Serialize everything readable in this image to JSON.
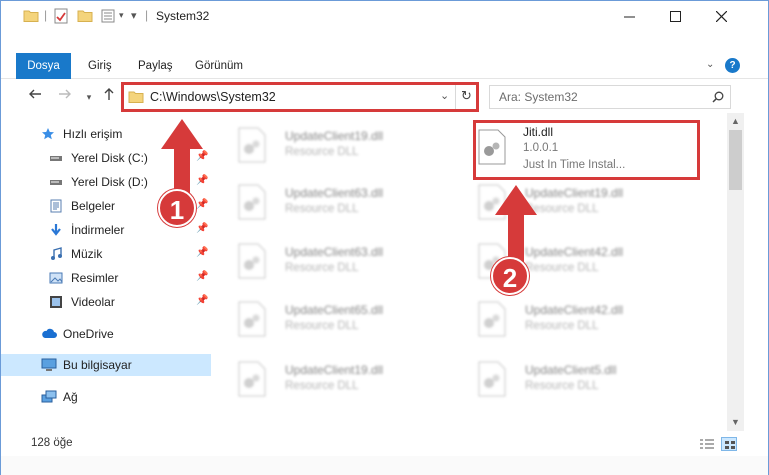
{
  "window": {
    "title": "System32"
  },
  "ribbon": {
    "tabs": [
      {
        "label": "Dosya",
        "active": true
      },
      {
        "label": "Giriş",
        "active": false
      },
      {
        "label": "Paylaş",
        "active": false
      },
      {
        "label": "Görünüm",
        "active": false
      }
    ]
  },
  "address": {
    "path": "C:\\Windows\\System32"
  },
  "search": {
    "placeholder": "Ara: System32"
  },
  "sidebar": {
    "items": [
      {
        "label": "Hızlı erişim"
      },
      {
        "label": "Yerel Disk (C:)"
      },
      {
        "label": "Yerel Disk (D:)"
      },
      {
        "label": "Belgeler"
      },
      {
        "label": "İndirmeler"
      },
      {
        "label": "Müzik"
      },
      {
        "label": "Resimler"
      },
      {
        "label": "Videolar"
      },
      {
        "label": "OneDrive"
      },
      {
        "label": "Bu bilgisayar"
      },
      {
        "label": "Ağ"
      }
    ]
  },
  "files": {
    "left": [
      {
        "name": "UpdateClient19.dll",
        "type": "Resource DLL"
      },
      {
        "name": "UpdateClient63.dll",
        "type": "Resource DLL"
      },
      {
        "name": "UpdateClient63.dll",
        "type": "Resource DLL"
      },
      {
        "name": "UpdateClient65.dll",
        "type": "Resource DLL"
      },
      {
        "name": "UpdateClient19.dll",
        "type": "Resource DLL"
      }
    ],
    "right": [
      {
        "name": "UpdateClient19.dll",
        "type": "Resource DLL"
      },
      {
        "name": "UpdateClient42.dll",
        "type": "Resource DLL"
      },
      {
        "name": "UpdateClient42.dll",
        "type": "Resource DLL"
      },
      {
        "name": "UpdateClient5.dll",
        "type": "Resource DLL"
      }
    ],
    "highlighted": {
      "name": "Jiti.dll",
      "version": "1.0.0.1",
      "description": "Just In Time Instal..."
    }
  },
  "status": {
    "count": "128 öğe"
  },
  "annotations": {
    "step1": "1",
    "step2": "2",
    "color": "#d63a3a"
  }
}
